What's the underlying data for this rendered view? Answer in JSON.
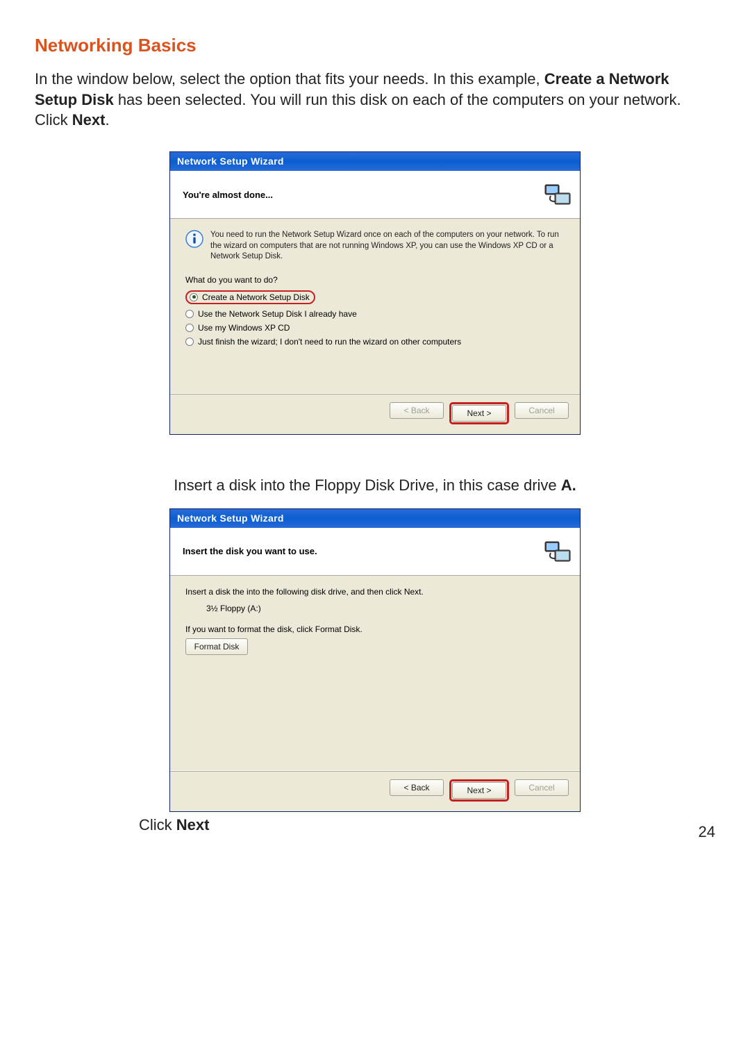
{
  "heading": "Networking Basics",
  "intro_parts": {
    "p1": "In the window below, select the option that fits your needs.  In this example, ",
    "bold1": "Create a Network Setup Disk",
    "p2": " has been selected.  You will run this disk on each of the computers on your network.  Click ",
    "bold2": "Next",
    "p3": "."
  },
  "wizard1": {
    "title": "Network Setup Wizard",
    "header": "You're almost done...",
    "info": "You need to run the Network Setup Wizard once on each of the computers on your network. To run the wizard on computers that are not running Windows XP, you can use the Windows XP CD or a Network Setup Disk.",
    "question": "What do you want to do?",
    "options": [
      {
        "label": "Create a Network Setup Disk",
        "checked": true,
        "highlighted": true
      },
      {
        "label": "Use the Network Setup Disk I already have",
        "checked": false,
        "highlighted": false
      },
      {
        "label": "Use my Windows XP CD",
        "checked": false,
        "highlighted": false
      },
      {
        "label": "Just finish the wizard; I don't need to run the wizard on other computers",
        "checked": false,
        "highlighted": false
      }
    ],
    "buttons": {
      "back": "< Back",
      "next": "Next >",
      "cancel": "Cancel",
      "next_highlighted": true,
      "back_disabled": true,
      "cancel_disabled": true
    }
  },
  "mid_text": {
    "p1": "Insert a disk into the Floppy Disk Drive, in this case drive ",
    "bold": "A.",
    "p2": ""
  },
  "wizard2": {
    "title": "Network Setup Wizard",
    "header": "Insert the disk you want to use.",
    "line1": "Insert a disk the into the following disk drive, and then click Next.",
    "drive": "3½ Floppy (A:)",
    "line2": "If you want to format the disk, click Format Disk.",
    "format_btn": "Format Disk",
    "buttons": {
      "back": "< Back",
      "next": "Next >",
      "cancel": "Cancel",
      "next_highlighted": true,
      "back_disabled": false,
      "cancel_disabled": true
    }
  },
  "caption2": {
    "p1": "Click ",
    "bold": "Next"
  },
  "page_number": "24"
}
